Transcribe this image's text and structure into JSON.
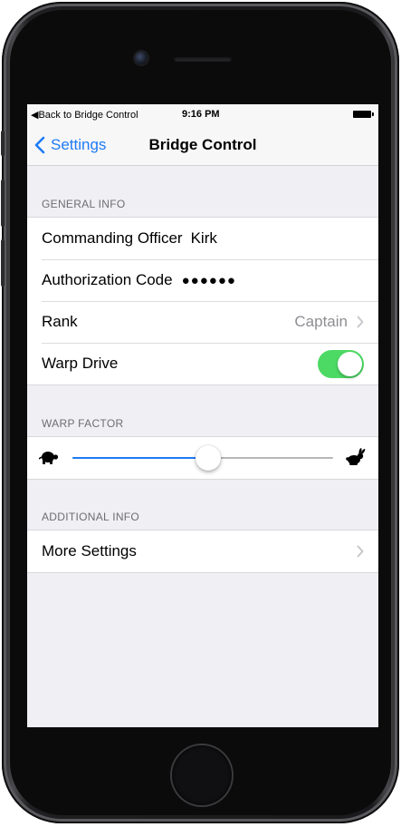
{
  "status_bar": {
    "back_label": "◀Back to Bridge Control",
    "time": "9:16 PM",
    "battery_icon": "battery-full-icon"
  },
  "nav": {
    "back_label": "Settings",
    "title": "Bridge Control",
    "accent": "#1e7bf6"
  },
  "general_info": {
    "header": "GENERAL INFO",
    "commanding_officer": {
      "label": "Commanding Officer",
      "value": "Kirk"
    },
    "authorization_code": {
      "label": "Authorization Code",
      "value": "●●●●●●"
    },
    "rank": {
      "label": "Rank",
      "value": "Captain"
    },
    "warp_drive": {
      "label": "Warp Drive",
      "on": true,
      "color": "#4cd964"
    }
  },
  "warp_factor": {
    "header": "WARP FACTOR",
    "level": 0.52,
    "min_icon": "tortoise-icon",
    "max_icon": "rabbit-icon"
  },
  "additional_info": {
    "header": "ADDITIONAL INFO",
    "more_settings": {
      "label": "More Settings"
    }
  }
}
